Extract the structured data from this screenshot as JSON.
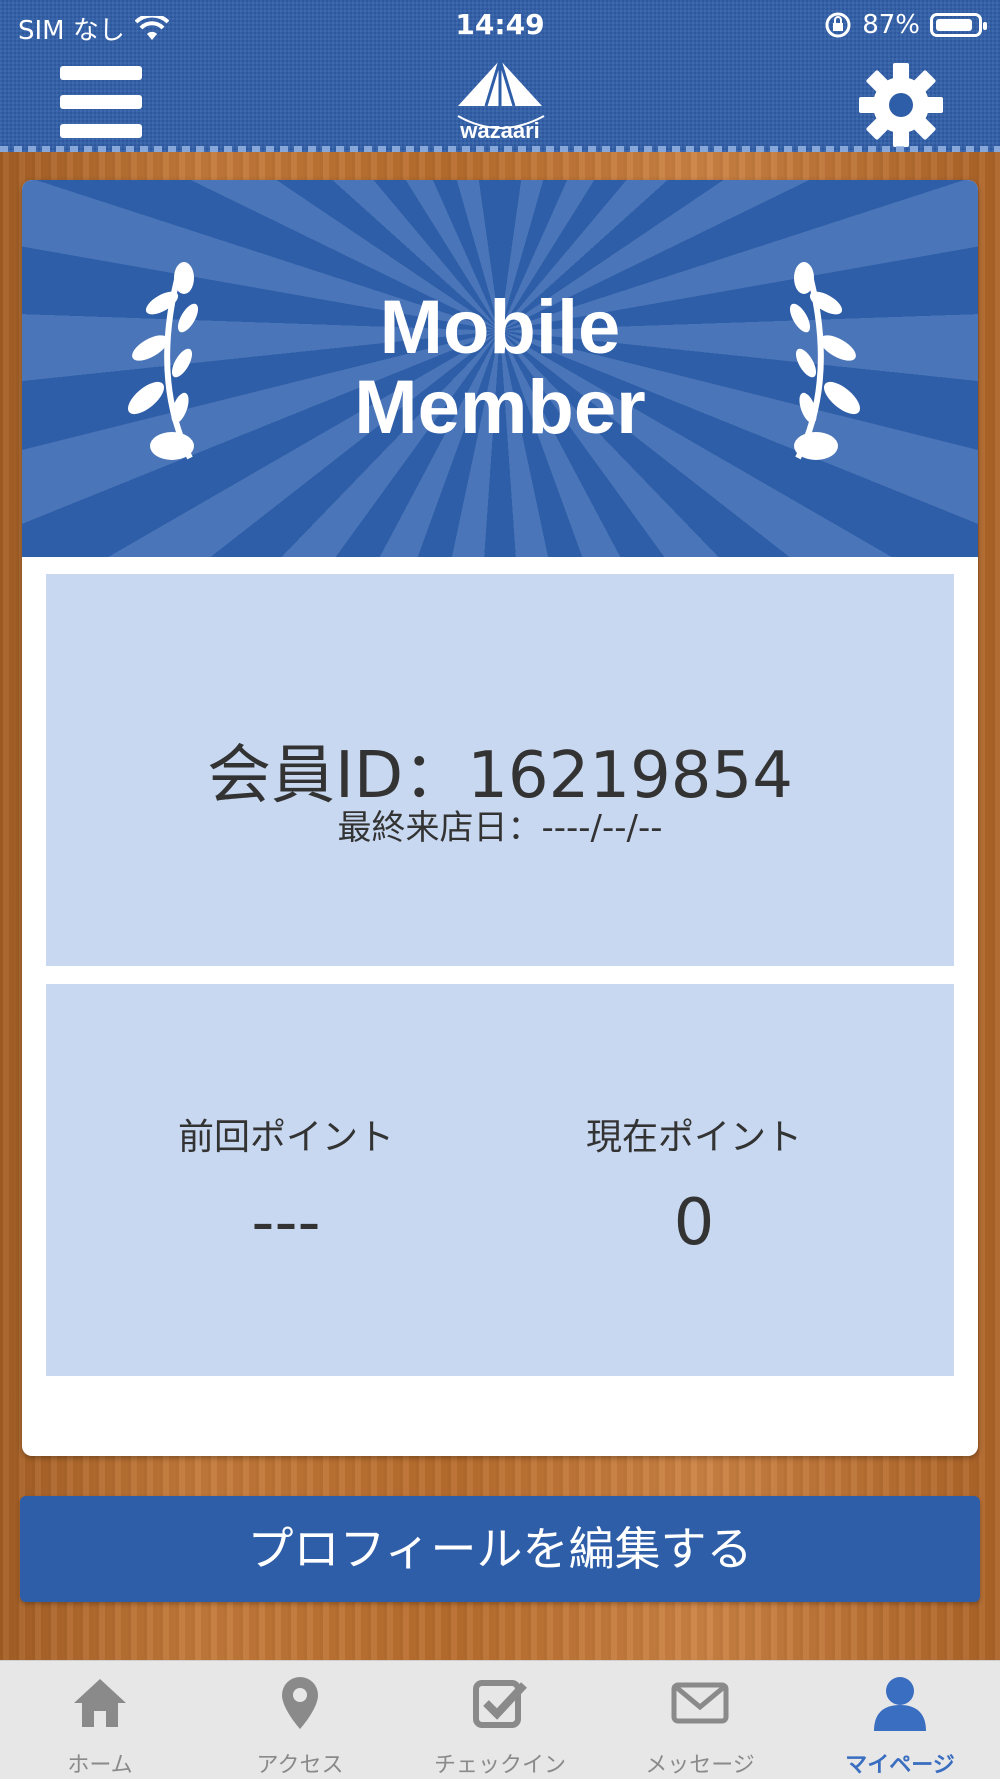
{
  "status_bar": {
    "carrier": "SIM なし",
    "time": "14:49",
    "battery": "87%"
  },
  "header": {
    "logo_text": "wazaari"
  },
  "banner": {
    "title_line1": "Mobile",
    "title_line2": "Member"
  },
  "member": {
    "id_text": "会員ID：16219854",
    "last_visit_text": "最終来店日：----/--/--"
  },
  "points": {
    "previous": {
      "label": "前回ポイント",
      "value": "---"
    },
    "current": {
      "label": "現在ポイント",
      "value": "0"
    }
  },
  "edit_button": {
    "label": "プロフィールを編集する"
  },
  "tabs": [
    {
      "label": "ホーム",
      "icon": "home-icon",
      "active": false
    },
    {
      "label": "アクセス",
      "icon": "map-pin-icon",
      "active": false
    },
    {
      "label": "チェックイン",
      "icon": "checkbox-icon",
      "active": false
    },
    {
      "label": "メッセージ",
      "icon": "envelope-icon",
      "active": false
    },
    {
      "label": "マイページ",
      "icon": "person-icon",
      "active": true
    }
  ],
  "colors": {
    "primary": "#2f5ea8",
    "panel": "#c8d8f0",
    "active_tab": "#3a6ec0",
    "inactive_tab": "#8a8a8a"
  }
}
